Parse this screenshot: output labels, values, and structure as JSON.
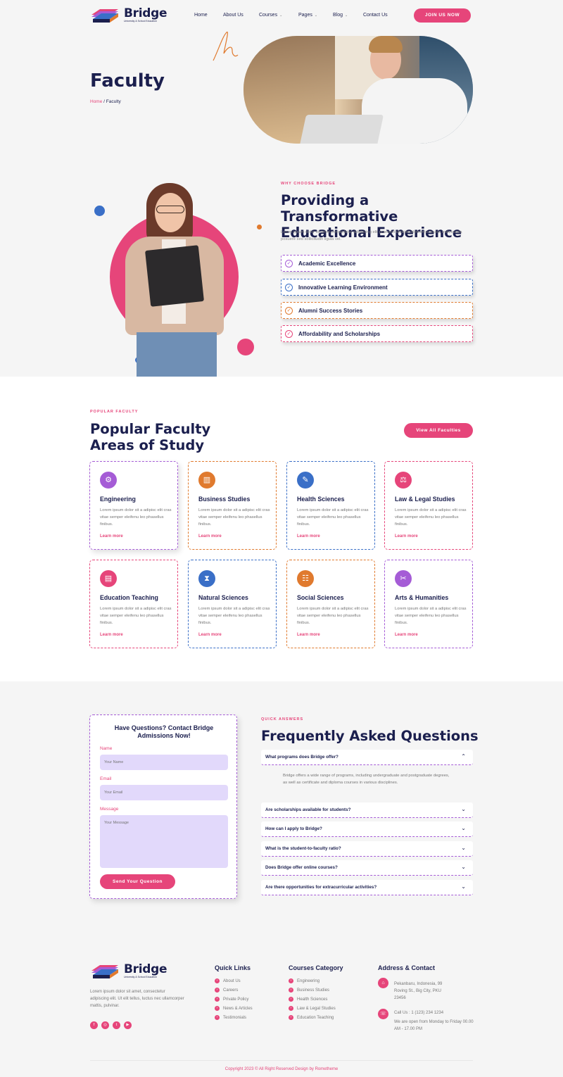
{
  "header": {
    "logo_name": "Bridge",
    "logo_sub": "University & School Education",
    "nav": [
      "Home",
      "About Us",
      "Courses",
      "Pages",
      "Blog",
      "Contact Us"
    ],
    "cta": "JOIN US NOW"
  },
  "hero": {
    "title": "Faculty",
    "breadcrumb_home": "Home",
    "breadcrumb_sep": " / ",
    "breadcrumb_current": "Faculty"
  },
  "why": {
    "eyebrow": "WHY CHOOSE BRIDGE",
    "title": "Providing a Transformative Educational Experience",
    "lede": "Lorem ipsum dolor sit amet consectetur adipiscing elit praesent ultricies elementu massa malesuada posuere sed sollicitudin ligula vel.",
    "features": [
      {
        "label": "Academic Excellence",
        "color": "#a55cd6"
      },
      {
        "label": "Innovative Learning Environment",
        "color": "#3a6fc7"
      },
      {
        "label": "Alumni Success Stories",
        "color": "#e07a2e"
      },
      {
        "label": "Affordability and Scholarships",
        "color": "#e6457a"
      }
    ]
  },
  "faculty": {
    "eyebrow": "POPULAR FACULTY",
    "title": "Popular Faculty Areas of Study",
    "view_all": "View All Faculties",
    "cards": [
      {
        "title": "Engineering",
        "icon": "gear-icon",
        "color": "#a55cd6",
        "desc": "Lorem ipsum dolor sit a adipisc elit cras vitae semper eleifenu leo phasellus finibus.",
        "link": "Learn more"
      },
      {
        "title": "Business Studies",
        "icon": "chart-icon",
        "color": "#e07a2e",
        "desc": "Lorem ipsum dolor sit a adipisc elit cras vitae semper eleifenu leo phasellus finibus.",
        "link": "Learn more"
      },
      {
        "title": "Health Sciences",
        "icon": "syringe-icon",
        "color": "#3a6fc7",
        "desc": "Lorem ipsum dolor sit a adipisc elit cras vitae semper eleifenu leo phasellus finibus.",
        "link": "Learn more"
      },
      {
        "title": "Law & Legal Studies",
        "icon": "gavel-icon",
        "color": "#e6457a",
        "desc": "Lorem ipsum dolor sit a adipisc elit cras vitae semper eleifenu leo phasellus finibus.",
        "link": "Learn more"
      },
      {
        "title": "Education Teaching",
        "icon": "book-icon",
        "color": "#e6457a",
        "desc": "Lorem ipsum dolor sit a adipisc elit cras vitae semper eleifenu leo phasellus finibus.",
        "link": "Learn more"
      },
      {
        "title": "Natural Sciences",
        "icon": "dna-icon",
        "color": "#3a6fc7",
        "desc": "Lorem ipsum dolor sit a adipisc elit cras vitae semper eleifenu leo phasellus finibus.",
        "link": "Learn more"
      },
      {
        "title": "Social Sciences",
        "icon": "people-icon",
        "color": "#e07a2e",
        "desc": "Lorem ipsum dolor sit a adipisc elit cras vitae semper eleifenu leo phasellus finibus.",
        "link": "Learn more"
      },
      {
        "title": "Arts & Humanities",
        "icon": "brush-icon",
        "color": "#a55cd6",
        "desc": "Lorem ipsum dolor sit a adipisc elit cras vitae semper eleifenu leo phasellus finibus.",
        "link": "Learn more"
      }
    ]
  },
  "contact_form": {
    "title": "Have Questions? Contact Bridge Admissions Now!",
    "name_label": "Name",
    "name_placeholder": "Your Name",
    "email_label": "Email",
    "email_placeholder": "Your Email",
    "message_label": "Message",
    "message_placeholder": "Your Message",
    "submit": "Send Your Question"
  },
  "faq": {
    "eyebrow": "QUICK ANSWERS",
    "title": "Frequently Asked Questions",
    "open_question": "What programs does Bridge offer?",
    "open_answer": "Bridge offers a wide range of programs, including undergraduate and postgraduate degrees, as well as certificate and diploma courses in various disciplines.",
    "questions": [
      "Are scholarships available for students?",
      "How can I apply to Bridge?",
      "What is the student-to-faculty ratio?",
      "Does Bridge offer online courses?",
      "Are there opportunities for extracurricular activities?"
    ]
  },
  "footer": {
    "about": "Lorem ipsum dolor sit amet, consectetur adipiscing elit. Ut elit tellus, luctus nec ullamcorper mattis, pulvinar.",
    "quick_links_title": "Quick Links",
    "quick_links": [
      "About Us",
      "Careers",
      "Private Policy",
      "News & Articles",
      "Testimonials"
    ],
    "courses_title": "Courses Category",
    "courses": [
      "Engineering",
      "Business Studies",
      "Health Sciences",
      "Law & Legal Studies",
      "Education Teaching"
    ],
    "address_title": "Address & Contact",
    "address": "Pekanbaru, Indonesia, 99 Roving St., Big City, PKU 23456",
    "phone": "Call Us : 1 (123) 234 1234",
    "hours": "We are open from Monday to Friday 00.00 AM - 17.00 PM",
    "copyright": "Copyright 2023 © All Right Reserved Design by Rometheme"
  }
}
